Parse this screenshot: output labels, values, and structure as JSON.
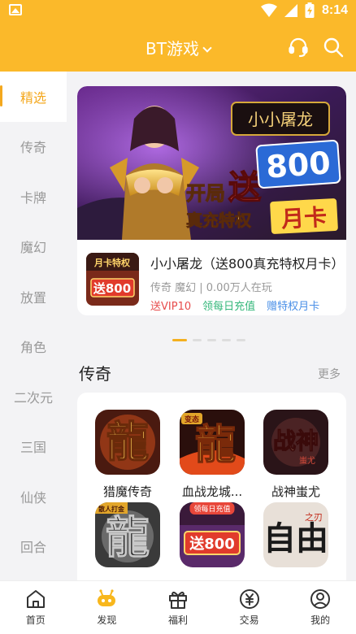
{
  "statusbar": {
    "time": "8:14"
  },
  "topbar": {
    "title": "BT游戏"
  },
  "sidebar": {
    "items": [
      {
        "label": "精选",
        "active": true
      },
      {
        "label": "传奇"
      },
      {
        "label": "卡牌"
      },
      {
        "label": "魔幻"
      },
      {
        "label": "放置"
      },
      {
        "label": "角色"
      },
      {
        "label": "二次元"
      },
      {
        "label": "三国"
      },
      {
        "label": "仙侠"
      },
      {
        "label": "回合"
      }
    ]
  },
  "featured": {
    "banner": {
      "logo_text": "小小屠龙",
      "line1_a": "开局",
      "line1_b": "送",
      "line1_c": "800",
      "line2_a": "真充特权",
      "line2_b": "月卡"
    },
    "thumb_top": "月卡特权",
    "thumb_bottom": "送800",
    "title": "小小屠龙（送800真充特权月卡）",
    "meta": "传奇 魔幻 | 0.00万人在玩",
    "tags": [
      "送VIP10",
      "领每日充值",
      "赠特权月卡"
    ]
  },
  "section": {
    "title": "传奇",
    "more": "更多"
  },
  "games": [
    {
      "name": "猎魔传奇",
      "glyph": "龍"
    },
    {
      "name": "血战龙城...",
      "glyph": "龍",
      "corner": "变态"
    },
    {
      "name": "战神蚩尤",
      "glyph": "战神",
      "sub": "蚩尤"
    },
    {
      "name": "",
      "glyph": "龍",
      "corner": "散人打金"
    },
    {
      "name": "",
      "glyph": "送800",
      "badge": "领每日充值"
    },
    {
      "name": "",
      "glyph": "自由",
      "sub": "之刃"
    }
  ],
  "nav": [
    {
      "label": "首页",
      "icon": "home-icon"
    },
    {
      "label": "发现",
      "icon": "discover-icon",
      "active": true
    },
    {
      "label": "福利",
      "icon": "gift-icon"
    },
    {
      "label": "交易",
      "icon": "yen-icon"
    },
    {
      "label": "我的",
      "icon": "profile-icon"
    }
  ],
  "colors": {
    "accent": "#fbb92a",
    "active": "#f4a81e"
  }
}
